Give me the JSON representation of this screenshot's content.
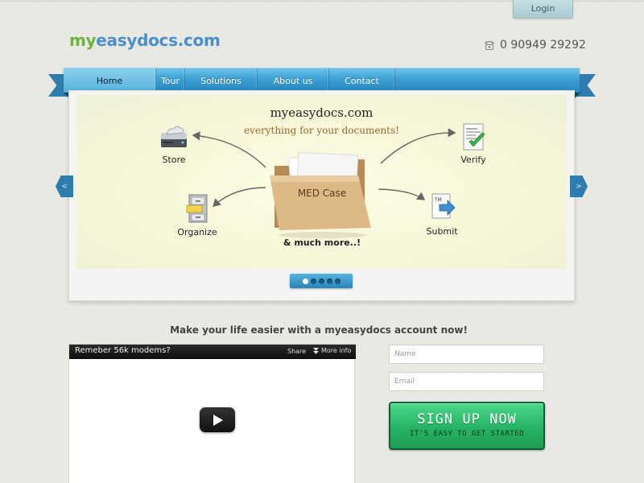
{
  "header": {
    "login_label": "Login",
    "logo": {
      "prefix": "my",
      "rest": "easydocs.com"
    },
    "phone": "0 90949 29292"
  },
  "nav": {
    "items": [
      {
        "label": "Home",
        "active": true
      },
      {
        "label": "Tour"
      },
      {
        "label": "Solutions"
      },
      {
        "label": "About us"
      },
      {
        "label": "Contact"
      }
    ]
  },
  "slider": {
    "title": "myeasydocs.com",
    "subtitle": "everything for your documents!",
    "folder_label": "MED Case",
    "more_label": "& much more..!",
    "features": {
      "store": "Store",
      "verify": "Verify",
      "organize": "Organize",
      "submit": "Submit"
    },
    "slide_count": 5,
    "active_slide": 1,
    "prev_label": "<",
    "next_label": ">"
  },
  "tagline": "Make your life easier with a myeasydocs account now!",
  "video": {
    "title": "Remeber 56k modems?",
    "share_label": "Share",
    "more_info_label": "More info"
  },
  "form": {
    "name_placeholder": "Name",
    "email_placeholder": "Email",
    "signup_label": "SIGN UP NOW",
    "signup_sub": "IT'S EASY TO GET STARTED"
  },
  "colors": {
    "nav_blue": "#3a9fd2",
    "ribbon_dark": "#2d7eaf",
    "logo_green": "#6db33f",
    "logo_blue": "#4a8fc9",
    "signup_green": "#27b365",
    "subtitle_brown": "#9a6a2c"
  }
}
